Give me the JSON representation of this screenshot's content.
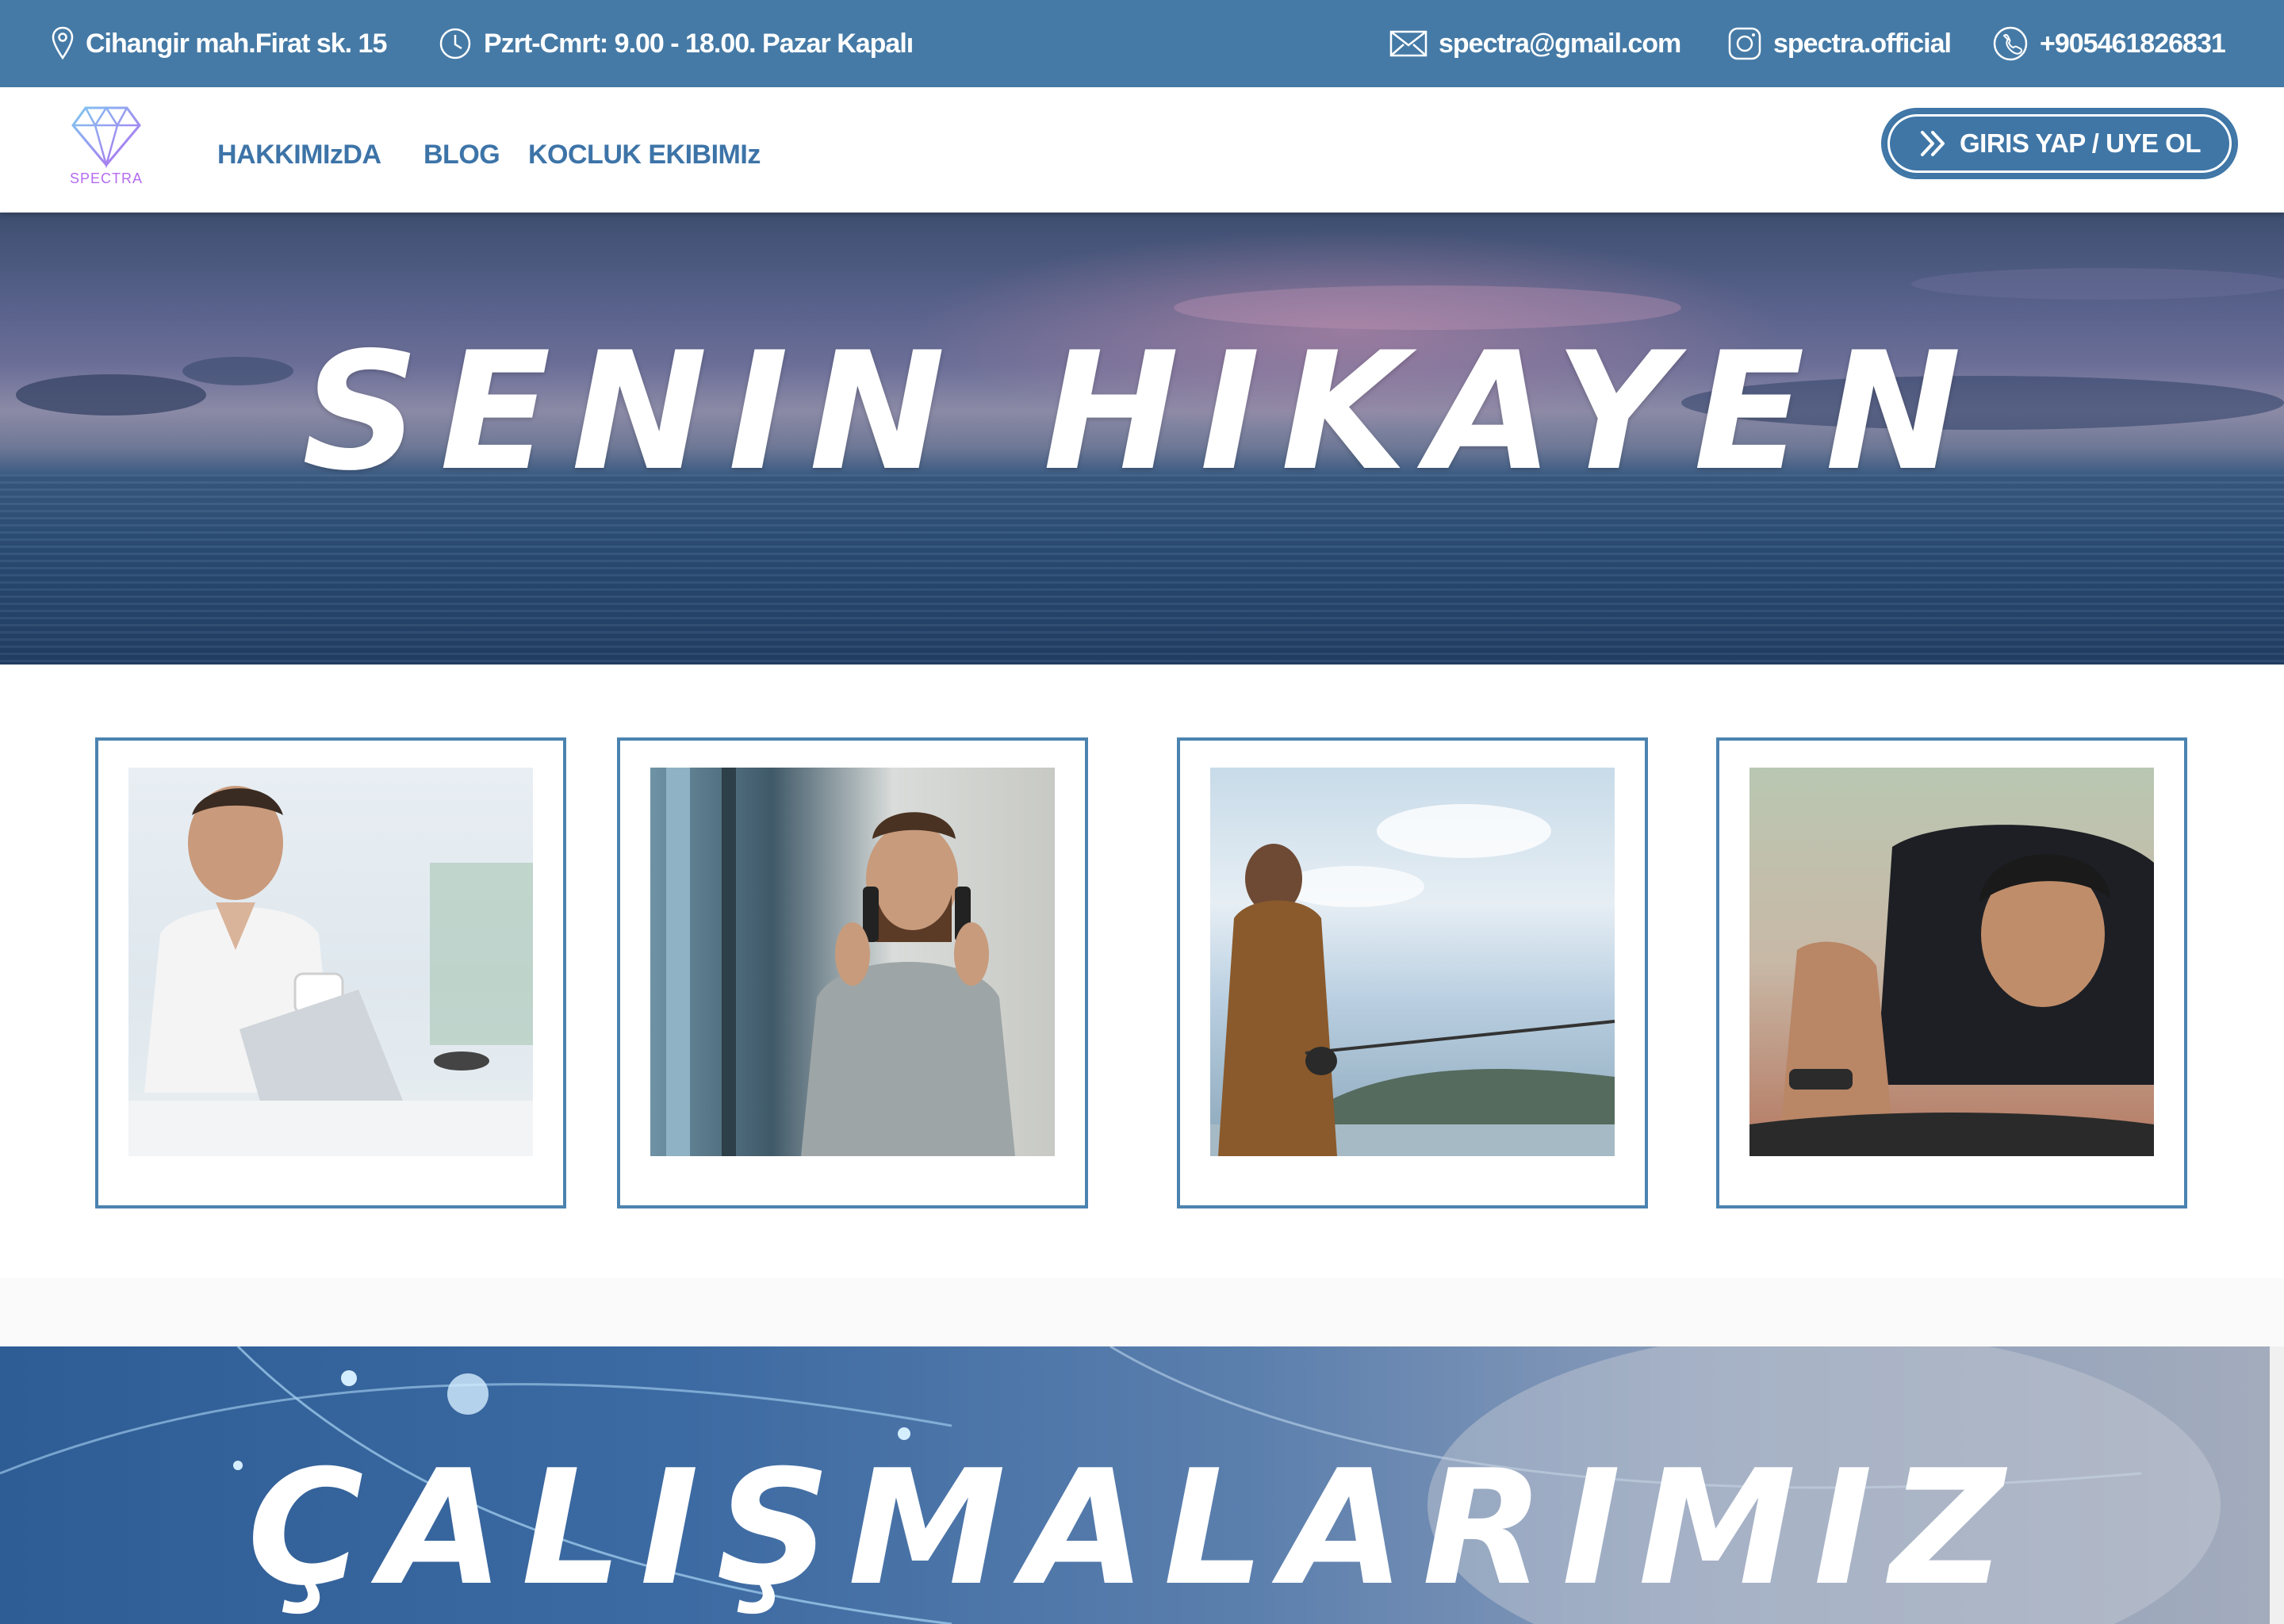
{
  "topbar": {
    "address": "Cihangir mah.Firat sk. 15",
    "hours": "Pzrt-Cmrt: 9.00 - 18.00. Pazar Kapalı",
    "email": "spectra@gmail.com",
    "instagram": "spectra.official",
    "phone": "+905461826831"
  },
  "nav": {
    "logo_text": "SPECTRA",
    "links": [
      "HAKKIMIzDA",
      "BLOG",
      "KOCLUK EKIBIMIz"
    ],
    "login_label": "GIRIS YAP / UYE OL"
  },
  "hero": {
    "title": "SENIN HIKAYEN"
  },
  "gallery": [
    {
      "subject": "man-with-laptop"
    },
    {
      "subject": "man-on-phones"
    },
    {
      "subject": "man-fishing"
    },
    {
      "subject": "man-pushup"
    }
  ],
  "section2": {
    "title": "ÇALIŞMALARIMIZ"
  },
  "colors": {
    "brand": "#457aa6",
    "accent": "#3d74a8",
    "logo": "#b46bf0"
  }
}
